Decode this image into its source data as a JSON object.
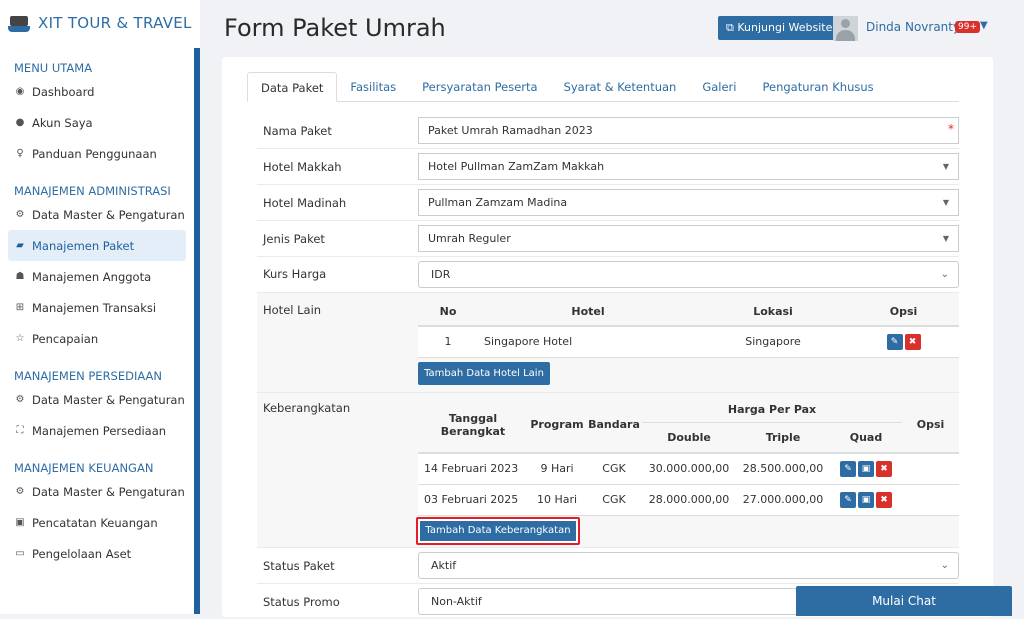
{
  "brand": "XIT TOUR & TRAVEL",
  "sidebar": {
    "s1": "MENU UTAMA",
    "i1": "Dashboard",
    "i2": "Akun Saya",
    "i3": "Panduan Penggunaan",
    "s2": "MANAJEMEN ADMINISTRASI",
    "i4": "Data Master & Pengaturan",
    "i5": "Manajemen Paket",
    "i6": "Manajemen Anggota",
    "i7": "Manajemen Transaksi",
    "i8": "Pencapaian",
    "s3": "MANAJEMEN PERSEDIAAN",
    "i9": "Data Master & Pengaturan",
    "i10": "Manajemen Persediaan",
    "s4": "MANAJEMEN KEUANGAN",
    "i11": "Data Master & Pengaturan",
    "i12": "Pencatatan Keuangan",
    "i13": "Pengelolaan Aset"
  },
  "header": {
    "title": "Form Paket Umrah",
    "visit": "Kunjungi Website",
    "user": "Dinda Novranty",
    "badge": "99+"
  },
  "tabs": [
    "Data Paket",
    "Fasilitas",
    "Persyaratan Peserta",
    "Syarat & Ketentuan",
    "Galeri",
    "Pengaturan Khusus"
  ],
  "form": {
    "nama_label": "Nama Paket",
    "nama_value": "Paket Umrah Ramadhan 2023",
    "makkah_label": "Hotel Makkah",
    "makkah_value": "Hotel Pullman ZamZam Makkah",
    "madinah_label": "Hotel Madinah",
    "madinah_value": "Pullman Zamzam Madina",
    "jenis_label": "Jenis Paket",
    "jenis_value": "Umrah Reguler",
    "kurs_label": "Kurs Harga",
    "kurs_value": "IDR",
    "hotel_lain_label": "Hotel Lain",
    "keberangkatan_label": "Keberangkatan",
    "status_label": "Status Paket",
    "status_value": "Aktif",
    "promo_label": "Status Promo",
    "promo_value": "Non-Aktif"
  },
  "hotel_table": {
    "headers": [
      "No",
      "Hotel",
      "Lokasi",
      "Opsi"
    ],
    "rows": [
      [
        "1",
        "Singapore Hotel",
        "Singapore"
      ]
    ],
    "add_button": "Tambah Data Hotel Lain"
  },
  "dep_table": {
    "h_tanggal": "Tanggal Berangkat",
    "h_program": "Program",
    "h_bandara": "Bandara",
    "h_harga": "Harga Per Pax",
    "h_opsi": "Opsi",
    "h_double": "Double",
    "h_triple": "Triple",
    "h_quad": "Quad",
    "rows": [
      [
        "14 Februari 2023",
        "9 Hari",
        "CGK",
        "30.000.000,00",
        "28.500.000,00"
      ],
      [
        "03 Februari 2025",
        "10 Hari",
        "CGK",
        "28.000.000,00",
        "27.000.000,00"
      ]
    ],
    "add_button": "Tambah Data Keberangkatan"
  },
  "chat": "Mulai Chat",
  "icons": {
    "edit": "pencil-icon",
    "money": "money-icon",
    "delete": "close-circle-icon"
  },
  "colors": {
    "primary": "#2e6da4",
    "danger": "#d9302c",
    "highlight": "#e21e26"
  }
}
